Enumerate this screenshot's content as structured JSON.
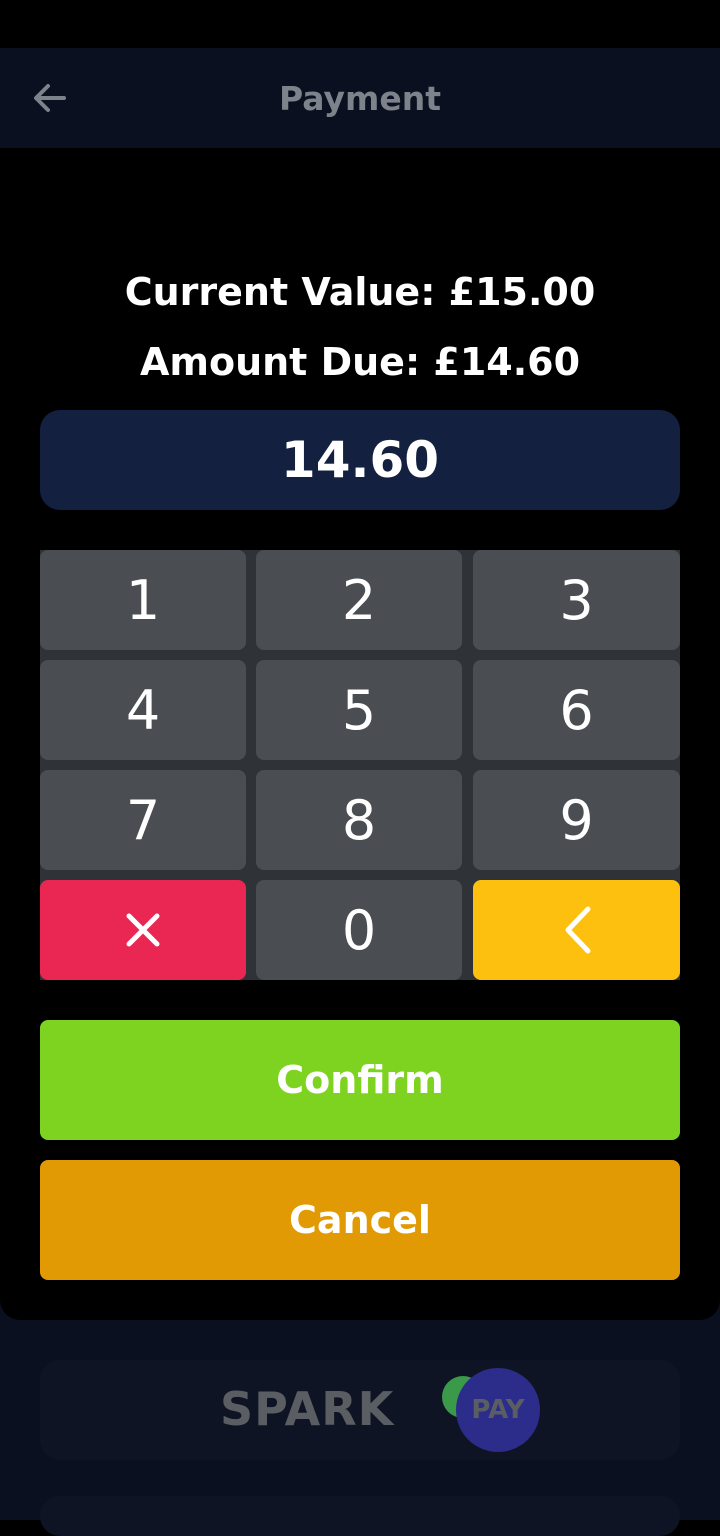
{
  "header": {
    "title": "Payment"
  },
  "summary": {
    "current_value": "Current Value: £15.00",
    "amount_due": "Amount Due: £14.60"
  },
  "amount_input": {
    "value": "14.60"
  },
  "keypad": {
    "keys": [
      "1",
      "2",
      "3",
      "4",
      "5",
      "6",
      "7",
      "8",
      "9"
    ],
    "zero": "0",
    "clear_icon": "close-icon",
    "backspace_icon": "chevron-left-icon"
  },
  "actions": {
    "confirm_label": "Confirm",
    "cancel_label": "Cancel"
  },
  "brand": {
    "name_part1": "SPARK",
    "name_part2": "PAY"
  },
  "colors": {
    "confirm": "#7ed321",
    "cancel": "#e19a04",
    "clear": "#ea2653",
    "backspace": "#fdc00f",
    "display": "#13203f"
  }
}
